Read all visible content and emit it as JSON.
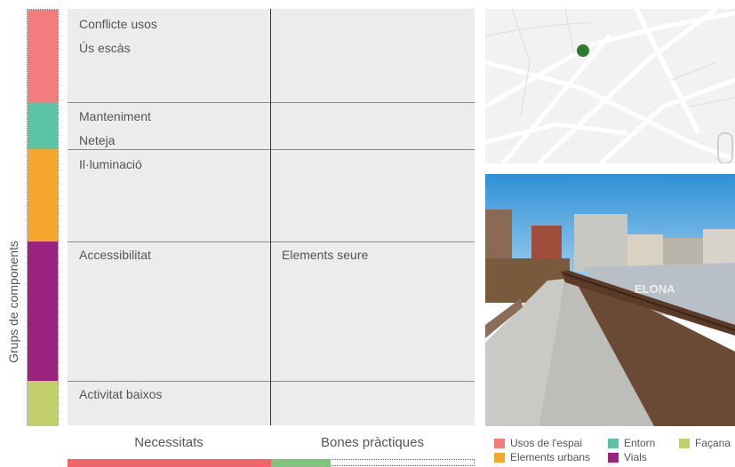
{
  "axis_title": "Grups de components",
  "colors": {
    "usos_espai": "#f47c7c",
    "entorn": "#5cc3a4",
    "elements_urbans": "#f5a62c",
    "vials": "#9b2380",
    "facana": "#c3cf6b",
    "grid_bg": "#ececec"
  },
  "rows": [
    {
      "lines": [
        "Conflicte usos",
        "Ús escàs"
      ],
      "practice": ""
    },
    {
      "lines": [
        "Manteniment",
        "Neteja"
      ],
      "practice": ""
    },
    {
      "lines": [
        "Il·luminació"
      ],
      "practice": ""
    },
    {
      "lines": [
        "Accessibilitat"
      ],
      "practice": "Elements seure"
    },
    {
      "lines": [
        "Activitat baixos"
      ],
      "practice": ""
    }
  ],
  "columns": {
    "needs": "Necessitats",
    "practices": "Bones pràctiques"
  },
  "photo_sign_text": "ELONA",
  "legend": {
    "usos_espai": "Usos de l'espai",
    "entorn": "Entorn",
    "facana": "Façana",
    "elements_urbans": "Elements urbans",
    "vials": "Vials"
  }
}
